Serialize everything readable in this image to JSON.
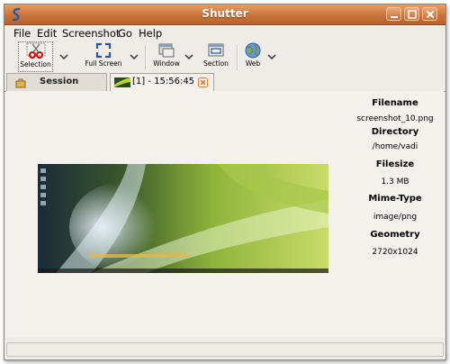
{
  "window": {
    "title": "Shutter",
    "titlebar_color": "#c9733a"
  },
  "menu": {
    "file": "File",
    "edit": "Edit",
    "screenshot": "Screenshot",
    "go": "Go",
    "help": "Help"
  },
  "toolbar": {
    "selection": "Selection",
    "full_screen": "Full Screen",
    "window": "Window",
    "section": "Section",
    "web": "Web"
  },
  "tabs": {
    "session": "Session",
    "active": "[1] - 15:56:45"
  },
  "info": {
    "filename_label": "Filename",
    "filename": "screenshot_10.png",
    "directory_label": "Directory",
    "directory": "/home/vadi",
    "filesize_label": "Filesize",
    "filesize": "1.3 MB",
    "mime_label": "Mime-Type",
    "mime": "image/png",
    "geometry_label": "Geometry",
    "geometry": "2720x1024"
  }
}
